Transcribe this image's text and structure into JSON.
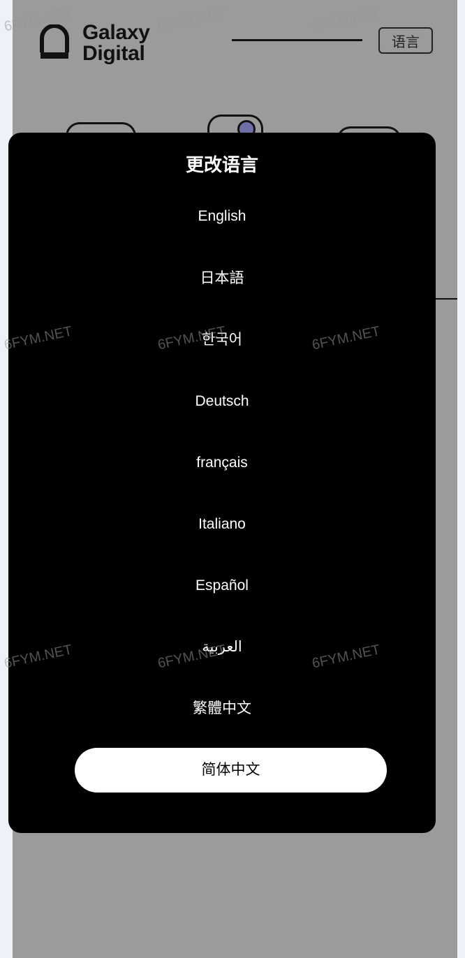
{
  "header": {
    "brand_line1": "Galaxy",
    "brand_line2": "Digital",
    "language_button": "语言"
  },
  "modal": {
    "title": "更改语言",
    "languages": [
      {
        "label": "English"
      },
      {
        "label": "日本語"
      },
      {
        "label": "한국어"
      },
      {
        "label": "Deutsch"
      },
      {
        "label": "français"
      },
      {
        "label": "Italiano"
      },
      {
        "label": "Español"
      },
      {
        "label": "العربية"
      },
      {
        "label": "繁體中文"
      },
      {
        "label": "简体中文",
        "selected": true
      }
    ]
  },
  "watermark": "6FYM.NET",
  "colors": {
    "page_background": "#9b9b9b",
    "modal_background": "#000000",
    "selected_pill": "#ffffff",
    "accent_dot": "#6d6fa6"
  }
}
